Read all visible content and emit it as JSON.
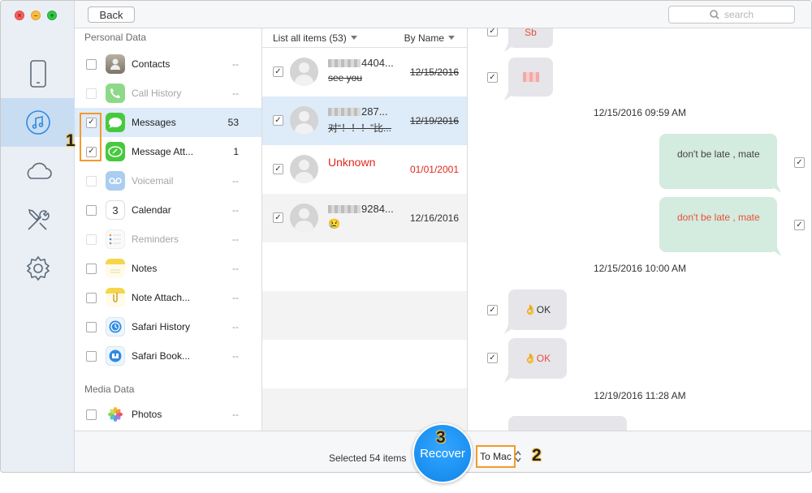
{
  "topbar": {
    "back_label": "Back",
    "search_placeholder": "search"
  },
  "nav": [
    "device-icon",
    "music-icon",
    "cloud-icon",
    "tools-icon",
    "settings-icon"
  ],
  "categories": {
    "personal_title": "Personal Data",
    "media_title": "Media Data",
    "items": [
      {
        "label": "Contacts",
        "count": "--"
      },
      {
        "label": "Call History",
        "count": "--"
      },
      {
        "label": "Messages",
        "count": "53"
      },
      {
        "label": "Message Att...",
        "count": "1"
      },
      {
        "label": "Voicemail",
        "count": "--"
      },
      {
        "label": "Calendar",
        "count": "--"
      },
      {
        "label": "Reminders",
        "count": "--"
      },
      {
        "label": "Notes",
        "count": "--"
      },
      {
        "label": "Note Attach...",
        "count": "--"
      },
      {
        "label": "Safari History",
        "count": "--"
      },
      {
        "label": "Safari Book...",
        "count": "--"
      },
      {
        "label": "Photos",
        "count": "--"
      }
    ],
    "calendar_day": "3"
  },
  "list": {
    "header_left": "List all items (53)",
    "header_right": "By Name",
    "conversations": [
      {
        "name": "4404...",
        "preview": "see you",
        "date": "12/15/2016"
      },
      {
        "name": "287...",
        "preview": "对“！！！”比...",
        "date": "12/19/2016"
      },
      {
        "name": "Unknown",
        "preview": "",
        "date": "01/01/2001"
      },
      {
        "name": "9284...",
        "preview": "😢",
        "date": "12/16/2016"
      }
    ]
  },
  "messages": {
    "top_bubble": "Sb",
    "ts1": "12/15/2016 09:59 AM",
    "out1": "don't be late , mate",
    "out2": "don't be late , mate",
    "ts2": "12/15/2016 10:00 AM",
    "in1": "👌OK",
    "in2": "👌OK",
    "ts3": "12/19/2016 11:28 AM"
  },
  "bottom": {
    "selected": "Selected 54 items",
    "recover": "Recover",
    "destination": "To Mac"
  },
  "steps": {
    "one": "1",
    "two": "2",
    "three": "3"
  },
  "colors": {
    "accent": "#1a8ff0",
    "highlight": "#f39a2b",
    "red_text": "#e0281b"
  }
}
